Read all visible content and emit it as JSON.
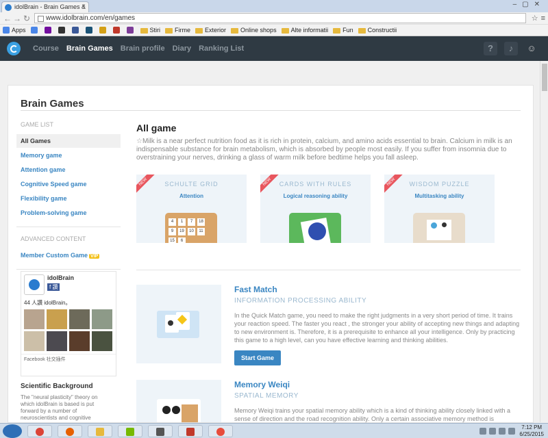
{
  "browser": {
    "tab_title": "idolBrain - Brain Games &",
    "url": "www.idolbrain.com/en/games",
    "bookmarks": [
      "Apps",
      "Stiri",
      "Firme",
      "Exterior",
      "Online shops",
      "Alte informatii",
      "Fun",
      "Constructii"
    ]
  },
  "navbar": {
    "items": [
      {
        "label": "Course",
        "active": false
      },
      {
        "label": "Brain Games",
        "active": true
      },
      {
        "label": "Brain profile",
        "active": false
      },
      {
        "label": "Diary",
        "active": false
      },
      {
        "label": "Ranking List",
        "active": false
      }
    ],
    "help_icon": "question-icon",
    "bell_icon": "bell-icon",
    "avatar_icon": "avatar-icon"
  },
  "page": {
    "title": "Brain Games"
  },
  "sidebar": {
    "game_list_caption": "GAME LIST",
    "items": [
      {
        "label": "All Games",
        "selected": true
      },
      {
        "label": "Memory game"
      },
      {
        "label": "Attention game"
      },
      {
        "label": "Cognitive Speed game"
      },
      {
        "label": "Flexibility game"
      },
      {
        "label": "Problem-solving game"
      }
    ],
    "advanced_caption": "ADVANCED CONTENT",
    "member_custom": "Member Custom Game",
    "vip_badge": "VIP"
  },
  "facebook": {
    "name": "idolBrain",
    "like_label": "讚",
    "likes": "44 人讚 idolBrain。",
    "footer": "Facebook 社交插件"
  },
  "science": {
    "title": "Scientific Background",
    "text": "The \"neural plasticity\" theory on which idolBrain is based is put forward by a number of neuroscientists and cognitive"
  },
  "main": {
    "title": "All game",
    "intro": "Milk is a near perfect nutrition food as it is rich in protein, calcium, and amino acids essential to brain. Calcium in milk is an indispensable substance for brain metabolism, which is absorbed by people most easily. If you suffer from insomnia due to overstraining your nerves, drinking a glass of warm milk before bedtime helps you fall asleep.",
    "new_label": "NEW",
    "tiles": [
      {
        "title": "SCHULTE GRID",
        "skill": "Attention",
        "color": "#d9a468"
      },
      {
        "title": "CARDS WITH RULES",
        "skill": "Logical reasoning ability",
        "color": "#5cb85c"
      },
      {
        "title": "WISDOM PUZZLE",
        "skill": "Multitasking ability",
        "color": "#e8dccb"
      }
    ],
    "schulte_numbers": [
      "4",
      "1",
      "7",
      "18",
      "9",
      "19",
      "10",
      "11",
      "15",
      "6"
    ],
    "games": [
      {
        "title": "Fast Match",
        "category": "INFORMATION PROCESSING ABILITY",
        "desc": "In the Quick Match game, you need to make the right judgments in a very short period of time. It trains your reaction speed. The faster you react , the stronger your ability of accepting new things and adapting to new environment is. Therefore, it is a prerequisite to enhance all your intelligence. Only by practicing this game to a high level, can you have effective learning and thinking abilities.",
        "button": "Start Game"
      },
      {
        "title": "Memory Weiqi",
        "category": "SPATIAL MEMORY",
        "desc": "Memory Weiqi trains your spatial memory ability which is a kind of thinking ability closely linked with a sense of direction and the road recognition ability. Only a certain associative memory method is"
      }
    ]
  },
  "taskbar": {
    "time": "7:12 PM",
    "date": "6/25/2015"
  }
}
